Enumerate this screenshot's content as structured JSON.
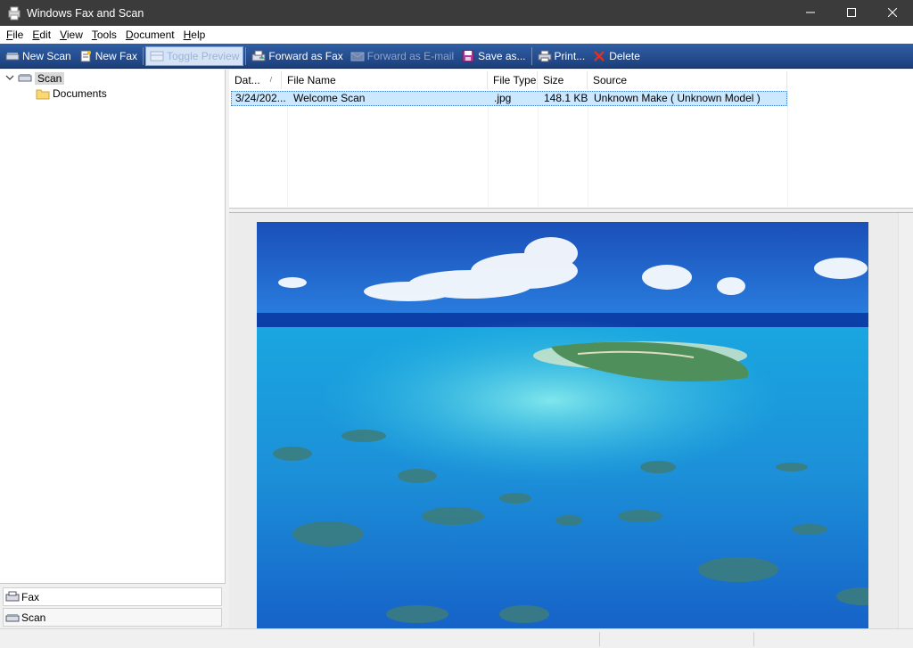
{
  "window": {
    "title": "Windows Fax and Scan",
    "controls": [
      "minimize-icon",
      "maximize-icon",
      "close-icon"
    ]
  },
  "menu": [
    {
      "accel": "F",
      "rest": "ile"
    },
    {
      "accel": "E",
      "rest": "dit"
    },
    {
      "accel": "V",
      "rest": "iew"
    },
    {
      "accel": "T",
      "rest": "ools"
    },
    {
      "accel": "D",
      "rest": "ocument"
    },
    {
      "accel": "H",
      "rest": "elp"
    }
  ],
  "toolbar": {
    "new_scan": "New Scan",
    "new_fax": "New Fax",
    "toggle_preview": "Toggle Preview",
    "forward_fax": "Forward as Fax",
    "forward_email": "Forward as E-mail",
    "save_as": "Save as...",
    "print": "Print...",
    "delete": "Delete"
  },
  "tree": {
    "root": "Scan",
    "child": "Documents"
  },
  "nav": {
    "fax": "Fax",
    "scan": "Scan"
  },
  "list": {
    "columns": [
      "Dat...",
      "File Name",
      "File Type",
      "Size",
      "Source"
    ],
    "sort_indicator": "/",
    "rows": [
      {
        "date": "3/24/202...",
        "name": "Welcome Scan",
        "type": ".jpg",
        "size": "148.1 KB",
        "source": "Unknown Make ( Unknown Model )"
      }
    ]
  },
  "colors": {
    "titlebar": "#3b3b3b",
    "toolbar": "#2f5fa6",
    "selection": "#cce8ff",
    "sea": "#1fa3d8",
    "sky": "#1b56c0"
  }
}
